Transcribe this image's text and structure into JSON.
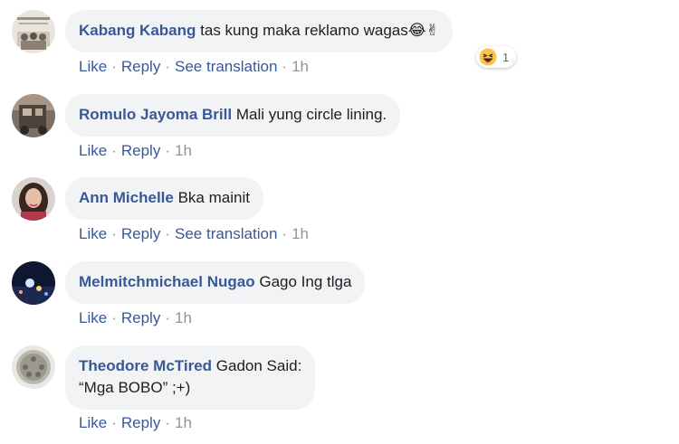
{
  "comments": [
    {
      "author": "Kabang Kabang",
      "text": "tas kung maka reklamo wagas😂✌",
      "actions": {
        "like": "Like",
        "reply": "Reply",
        "translate": "See translation",
        "time": "1h"
      },
      "reaction_count": "1",
      "avatar": "group-photo-avatar"
    },
    {
      "author": "Romulo Jayoma Brill",
      "text": "Mali yung circle lining.",
      "actions": {
        "like": "Like",
        "reply": "Reply",
        "time": "1h"
      },
      "avatar": "photo-avatar"
    },
    {
      "author": "Ann Michelle",
      "text": "Bka mainit",
      "actions": {
        "like": "Like",
        "reply": "Reply",
        "translate": "See translation",
        "time": "1h"
      },
      "avatar": "woman-photo-avatar"
    },
    {
      "author": "Melmitchmichael Nugao",
      "text": "Gago Ing tlga",
      "actions": {
        "like": "Like",
        "reply": "Reply",
        "time": "1h"
      },
      "avatar": "night-photo-avatar"
    },
    {
      "author": "Theodore McTired",
      "text_line1": "Gadon Said:",
      "text_line2": "“Mga BOBO” ;+)",
      "actions": {
        "like": "Like",
        "reply": "Reply",
        "time": "1h"
      },
      "avatar": "drum-photo-avatar"
    }
  ],
  "colors": {
    "link": "#385898",
    "muted": "#90949c",
    "bubble": "#f2f3f5",
    "text": "#1c1e21"
  }
}
